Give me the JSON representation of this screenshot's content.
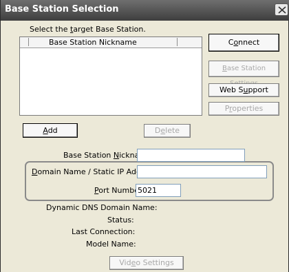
{
  "window": {
    "title": "Base Station Selection"
  },
  "instruction": {
    "prefix": "Select the ",
    "underlined": "t",
    "suffix": "arget Base Station."
  },
  "list": {
    "column_header": "Base Station Nickname",
    "rows": []
  },
  "buttons": {
    "connect": {
      "prefix": "C",
      "underlined": "o",
      "suffix": "nnect"
    },
    "base_station_settings": {
      "prefix": "",
      "underlined": "B",
      "suffix": "ase Station Settings"
    },
    "web_support": {
      "prefix": "Web S",
      "underlined": "u",
      "suffix": "pport"
    },
    "properties": {
      "prefix": "P",
      "underlined": "r",
      "suffix": "operties"
    },
    "add": {
      "prefix": "",
      "underlined": "A",
      "suffix": "dd"
    },
    "delete": {
      "prefix": "D",
      "underlined": "e",
      "suffix": "lete"
    },
    "video_settings": {
      "prefix": "Vid",
      "underlined": "e",
      "suffix": "o Settings"
    }
  },
  "form": {
    "nickname_label": {
      "prefix": "Base Station ",
      "underlined": "N",
      "suffix": "ickname"
    },
    "nickname_value": "",
    "domain_label": {
      "prefix": "",
      "underlined": "D",
      "suffix": "omain Name / Static IP Address"
    },
    "domain_value": "",
    "port_label": {
      "prefix": "",
      "underlined": "P",
      "suffix": "ort Number"
    },
    "port_value": "5021"
  },
  "info": {
    "ddns_label": "Dynamic DNS Domain Name:",
    "status_label": "Status:",
    "last_connection_label": "Last Connection:",
    "model_name_label": "Model Name:"
  },
  "colors": {
    "titlebar": "#4a4a4a",
    "dialog_bg": "#ece9d8",
    "disabled_text": "#a8a8a8"
  }
}
